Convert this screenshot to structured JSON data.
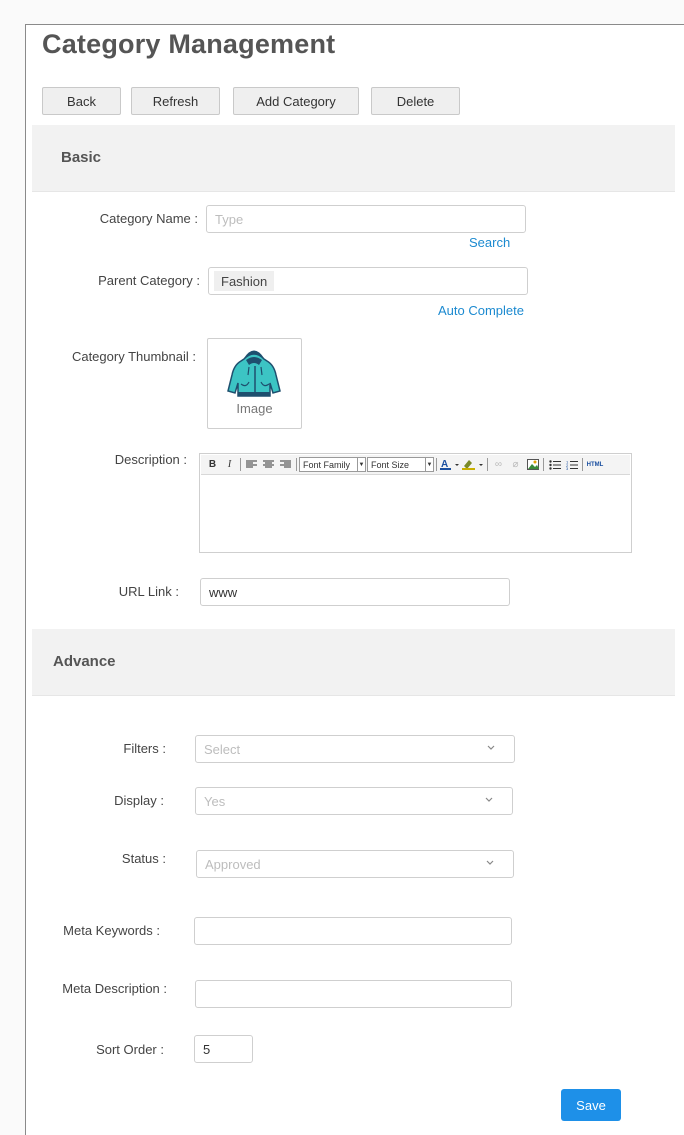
{
  "page": {
    "title": "Category Management"
  },
  "toolbar": {
    "back_label": "Back",
    "refresh_label": "Refresh",
    "add_label": "Add Category",
    "delete_label": "Delete"
  },
  "basic": {
    "section_title": "Basic",
    "category_name": {
      "label": "Category Name :",
      "placeholder": "Type",
      "value": "",
      "search_link": "Search"
    },
    "parent_category": {
      "label": "Parent Category :",
      "value": "Fashion",
      "autocomplete_link": "Auto Complete"
    },
    "thumbnail": {
      "label": "Category Thumbnail :",
      "caption": "Image",
      "icon": "hoodie-icon"
    },
    "description": {
      "label": "Description :",
      "font_family": "Font Family",
      "font_size": "Font Size",
      "html_label": "HTML",
      "value": ""
    },
    "url_link": {
      "label": "URL Link :",
      "value": "www"
    }
  },
  "advance": {
    "section_title": "Advance",
    "filters": {
      "label": "Filters :",
      "value": "Select"
    },
    "display": {
      "label": "Display :",
      "value": "Yes"
    },
    "status": {
      "label": "Status :",
      "value": "Approved"
    },
    "meta_keywords": {
      "label": "Meta Keywords :",
      "value": ""
    },
    "meta_description": {
      "label": "Meta Description :",
      "value": ""
    },
    "sort_order": {
      "label": "Sort Order :",
      "value": "5"
    }
  },
  "save_label": "Save",
  "colors": {
    "accent": "#1e90e8",
    "link": "#1c8ad0",
    "section_bg": "#f2f2f2",
    "hoodie": "#3cc4c4"
  }
}
